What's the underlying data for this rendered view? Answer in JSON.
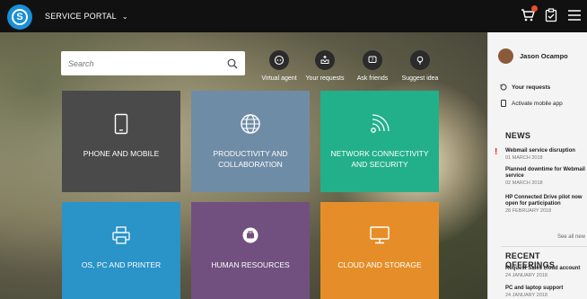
{
  "header": {
    "portal_label": "SERVICE PORTAL",
    "accent_color": "#1a8fd6",
    "bar_color": "#111111",
    "cart_badge_color": "#e8502a"
  },
  "search": {
    "placeholder": "Search"
  },
  "quick_actions": [
    {
      "label": "Virtual agent",
      "icon": "chat-bot-icon"
    },
    {
      "label": "Your requests",
      "icon": "inbox-icon"
    },
    {
      "label": "Ask friends",
      "icon": "question-bubble-icon"
    },
    {
      "label": "Suggest idea",
      "icon": "lightbulb-icon"
    }
  ],
  "tiles": [
    {
      "label": "PHONE AND MOBILE",
      "color": "#4a4a4a",
      "icon": "phone-icon"
    },
    {
      "label": "PRODUCTIVITY AND COLLABORATION",
      "color": "#6f8ca6",
      "icon": "globe-icon"
    },
    {
      "label": "NETWORK CONNECTIVITY AND SECURITY",
      "color": "#22b08a",
      "icon": "wifi-icon"
    },
    {
      "label": "OS, PC AND PRINTER",
      "color": "#2a93c7",
      "icon": "printer-icon"
    },
    {
      "label": "HUMAN RESOURCES",
      "color": "#71507f",
      "icon": "badge-icon"
    },
    {
      "label": "CLOUD AND STORAGE",
      "color": "#e58e29",
      "icon": "monitor-icon"
    }
  ],
  "panel": {
    "user_name": "Jason Ocampo",
    "links": [
      {
        "label": "Your requests",
        "icon": "requests-icon"
      },
      {
        "label": "Activate mobile app",
        "icon": "mobile-icon"
      }
    ],
    "news_title": "NEWS",
    "news": [
      {
        "title": "Webmail service disruption",
        "date": "01 MARCH 2018"
      },
      {
        "title": "Planned downtime for Webmail service",
        "date": "02 MARCH 2018"
      },
      {
        "title": "HP Connected Drive pilot now open for participation",
        "date": "28 FEBRUARY 2018"
      }
    ],
    "see_all": "See all new",
    "offerings_title": "RECENT OFFERINGS",
    "offerings": [
      {
        "title": "Request Sales cloud account",
        "date": "24 JANUARY 2018"
      },
      {
        "title": "PC and laptop support",
        "date": "24 JANUARY 2018"
      }
    ]
  }
}
